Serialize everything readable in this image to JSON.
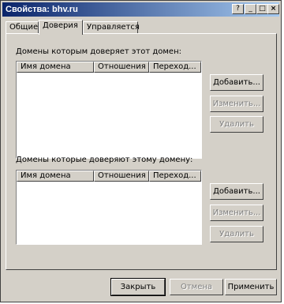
{
  "window": {
    "title": "Свойства: bhv.ru"
  },
  "title_buttons": {
    "help": "?",
    "minimize": "_",
    "maximize": "□",
    "close": "×"
  },
  "tabs": [
    {
      "label": "Общие"
    },
    {
      "label": "Доверия"
    },
    {
      "label": "Управляется"
    }
  ],
  "trusted_by_this": {
    "label": "Домены которым доверяет этот домен:",
    "columns": [
      "Имя домена",
      "Отношения",
      "Переход..."
    ],
    "buttons": {
      "add": "Добавить...",
      "edit": "Изменить...",
      "remove": "Удалить"
    }
  },
  "trusting_this": {
    "label": "Домены которые доверяют этому домену:",
    "columns": [
      "Имя домена",
      "Отношения",
      "Переход..."
    ],
    "buttons": {
      "add": "Добавить...",
      "edit": "Изменить...",
      "remove": "Удалить"
    }
  },
  "footer": {
    "ok": "Закрыть",
    "cancel": "Отмена",
    "apply": "Применить"
  }
}
